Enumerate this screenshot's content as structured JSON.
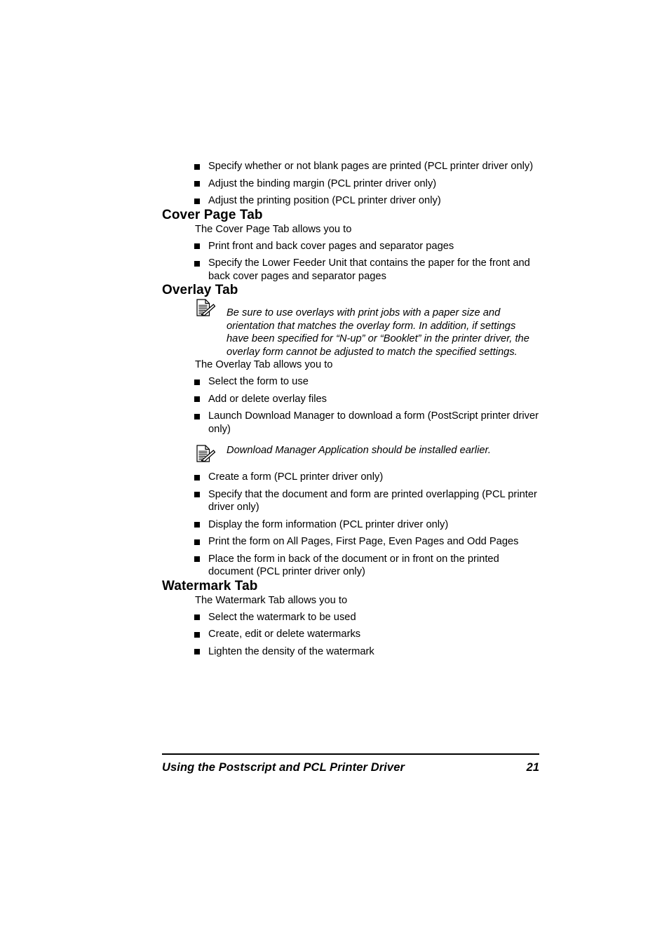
{
  "document": {
    "page_background": "#ffffff",
    "text_color": "#000000"
  },
  "top_bullets": [
    "Specify whether or not blank pages are printed (PCL printer driver only)",
    "Adjust the binding margin (PCL printer driver only)",
    "Adjust the printing position (PCL printer driver only)"
  ],
  "sections": [
    {
      "heading": "Cover Page Tab",
      "intro": "The Cover Page Tab allows you to",
      "bullets": [
        "Print front and back cover pages and separator pages",
        "Specify the Lower Feeder Unit that contains the paper for the front and back cover pages and separator pages"
      ]
    },
    {
      "heading": "Overlay Tab",
      "note_1": "Be sure to use overlays with print jobs with a paper size and orientation that matches the overlay form.\nIn addition, if settings have been specified for “N-up” or “Booklet” in the printer driver, the overlay form cannot be adjusted to match the specified settings.",
      "intro": "The Overlay Tab allows you to",
      "bullets_before_note": [
        "Select the form to use",
        "Add or delete overlay files",
        "Launch Download Manager to download a form (PostScript printer driver only)"
      ],
      "note_2": "Download Manager Application should be installed earlier.",
      "bullets_after_note": [
        "Create a form (PCL printer driver only)",
        "Specify that the document and form are printed overlapping (PCL printer driver only)",
        "Display the form information (PCL printer driver only)",
        "Print the form on All Pages, First Page, Even Pages and Odd Pages",
        "Place the form in back of the document or in front on the printed document (PCL printer driver only)"
      ]
    },
    {
      "heading": "Watermark Tab",
      "intro": "The Watermark Tab allows you to",
      "bullets": [
        "Select the watermark to be used",
        "Create, edit or delete watermarks",
        "Lighten the density of the watermark"
      ]
    }
  ],
  "footer": {
    "title": "Using the Postscript and PCL Printer Driver",
    "page_number": "21"
  },
  "icons": {
    "note": "note-pen-document-icon",
    "bullet": "filled-square-bullet"
  }
}
